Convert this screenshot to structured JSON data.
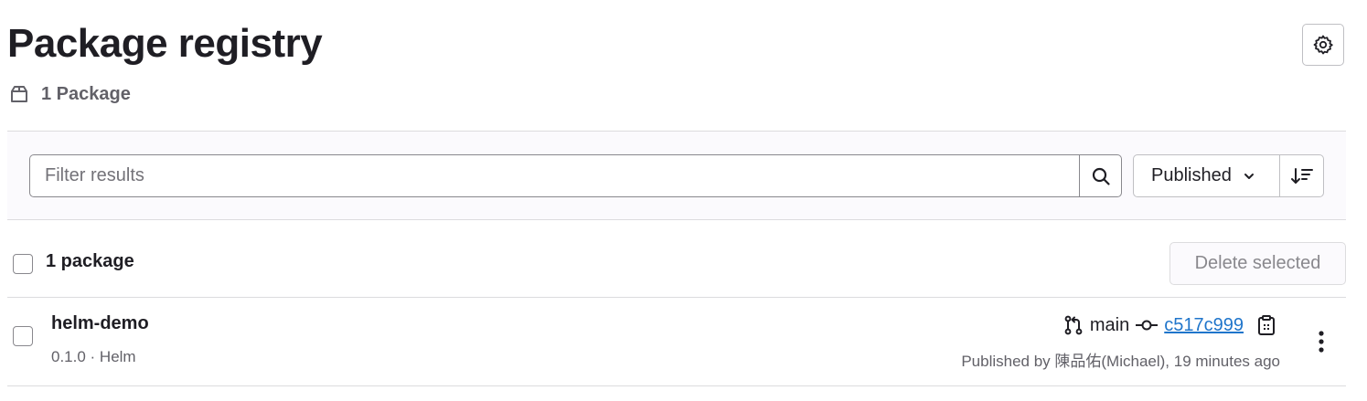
{
  "header": {
    "title": "Package registry",
    "package_count": "1 Package",
    "settings_icon": "gear-icon",
    "count_icon": "package-icon"
  },
  "filter": {
    "placeholder": "Filter results",
    "value": "",
    "search_icon": "search-icon",
    "sort_label": "Published",
    "sort_icon": "sort-lowest-icon"
  },
  "list": {
    "header_label": "1 package",
    "delete_label": "Delete selected",
    "items": [
      {
        "name": "helm-demo",
        "version": "0.1.0",
        "type": "Helm",
        "meta": "0.1.0 · Helm",
        "branch": "main",
        "commit": "c517c999",
        "published": "Published by 陳品佑(Michael), 19 minutes ago"
      }
    ]
  },
  "colors": {
    "link": "#1f75cb",
    "text": "#1f1e24",
    "muted": "#626168",
    "border": "#dcdcde"
  }
}
